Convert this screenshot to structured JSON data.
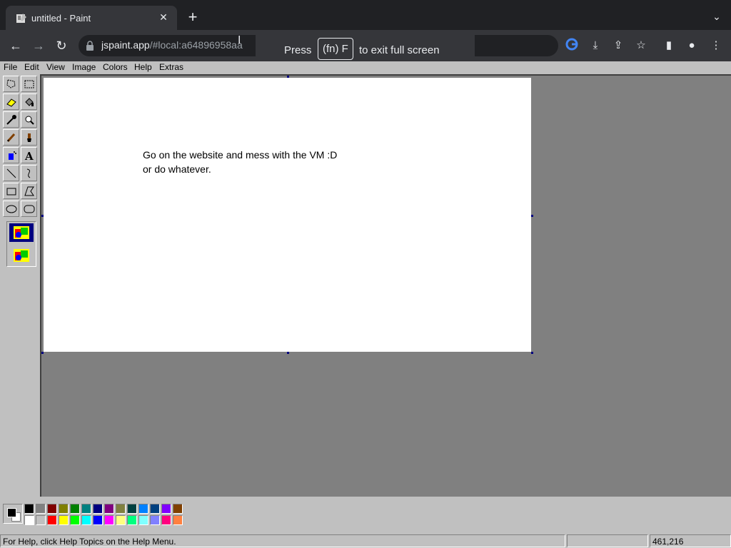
{
  "browser": {
    "tab_title": "untitled - Paint",
    "url_host": "jspaint.app",
    "url_path": "/#local:a64896958aa",
    "fullscreen_notice": {
      "prefix": "Press",
      "key": "(fn) F",
      "suffix": "to exit full screen"
    }
  },
  "menus": [
    "File",
    "Edit",
    "View",
    "Image",
    "Colors",
    "Help",
    "Extras"
  ],
  "canvas": {
    "text_line1": "Go on the website and mess with the VM :D",
    "text_line2": "or do whatever."
  },
  "palette": {
    "top": [
      "#000000",
      "#808080",
      "#800000",
      "#808000",
      "#008000",
      "#008080",
      "#000080",
      "#800080",
      "#808040",
      "#004040",
      "#0080ff",
      "#004080",
      "#8000ff",
      "#804000"
    ],
    "bottom": [
      "#ffffff",
      "#c0c0c0",
      "#ff0000",
      "#ffff00",
      "#00ff00",
      "#00ffff",
      "#0000ff",
      "#ff00ff",
      "#ffff80",
      "#00ff80",
      "#80ffff",
      "#8080ff",
      "#ff0080",
      "#ff8040"
    ],
    "foreground": "#000000",
    "background": "#ffffff"
  },
  "status": {
    "help_text": "For Help, click Help Topics on the Help Menu.",
    "size_text": "",
    "coords": "461,216"
  }
}
